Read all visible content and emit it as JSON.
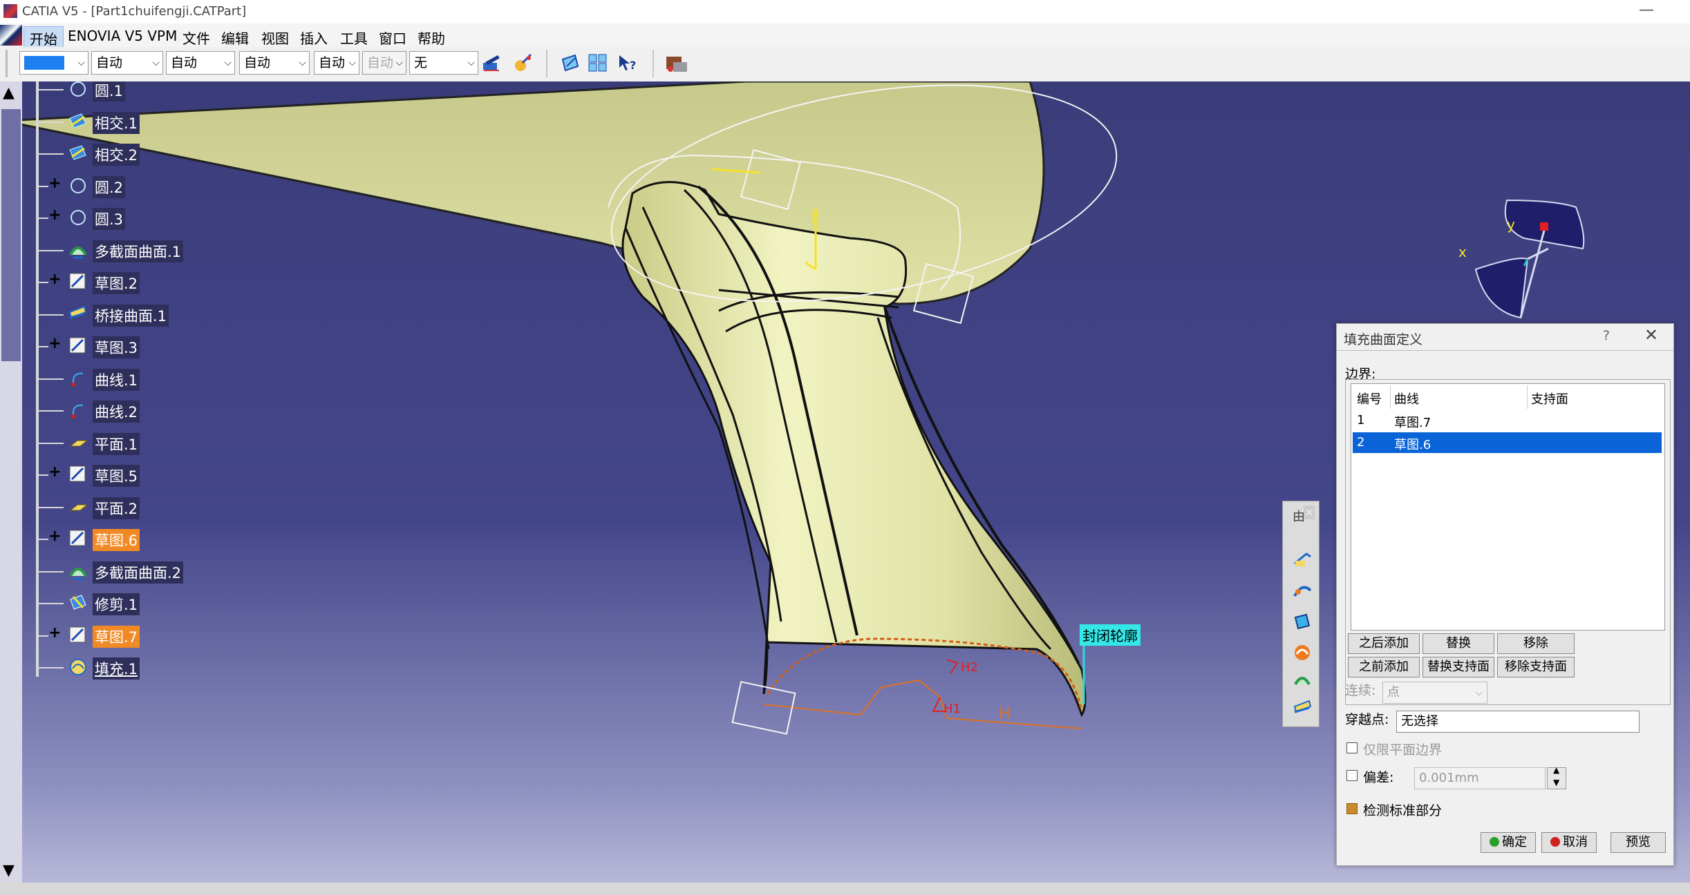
{
  "window": {
    "title": "CATIA V5 - [Part1chuifengji.CATPart]",
    "minimize": "—"
  },
  "menu": {
    "items": [
      "开始",
      "ENOVIA V5 VPM",
      "文件",
      "编辑",
      "视图",
      "插入",
      "工具",
      "窗口",
      "帮助"
    ]
  },
  "toolbar": {
    "color_value": "",
    "combos": [
      "自动",
      "自动",
      "自动",
      "自动",
      "自动",
      "无"
    ]
  },
  "tree": {
    "items": [
      {
        "label": "圆.1",
        "icon": "circle-icon"
      },
      {
        "label": "相交.1",
        "icon": "intersect-icon"
      },
      {
        "label": "相交.2",
        "icon": "intersect-icon"
      },
      {
        "label": "圆.2",
        "icon": "circle-icon"
      },
      {
        "label": "圆.3",
        "icon": "circle-icon"
      },
      {
        "label": "多截面曲面.1",
        "icon": "multisection-surface-icon"
      },
      {
        "label": "草图.2",
        "icon": "sketch-icon"
      },
      {
        "label": "桥接曲面.1",
        "icon": "blend-surface-icon"
      },
      {
        "label": "草图.3",
        "icon": "sketch-icon"
      },
      {
        "label": "曲线.1",
        "icon": "curve-icon"
      },
      {
        "label": "曲线.2",
        "icon": "curve-icon"
      },
      {
        "label": "平面.1",
        "icon": "plane-icon"
      },
      {
        "label": "草图.5",
        "icon": "sketch-icon"
      },
      {
        "label": "平面.2",
        "icon": "plane-icon"
      },
      {
        "label": "草图.6",
        "icon": "sketch-icon"
      },
      {
        "label": "多截面曲面.2",
        "icon": "multisection-surface-icon"
      },
      {
        "label": "修剪.1",
        "icon": "trim-icon"
      },
      {
        "label": "草图.7",
        "icon": "sketch-icon"
      },
      {
        "label": "填充.1",
        "icon": "fill-icon"
      }
    ]
  },
  "viewport": {
    "annotation_label": "封闭轮廓",
    "dim_labels": [
      "H",
      "H1",
      "H2"
    ],
    "axis_labels": {
      "x": "x",
      "y": "y"
    },
    "sketch_axis": "y"
  },
  "palette": {
    "title": "由",
    "close": "×"
  },
  "dialog": {
    "title": "填充曲面定义",
    "help": "?",
    "close": "✕",
    "boundary_label": "边界:",
    "columns": [
      "编号",
      "曲线",
      "支持面"
    ],
    "rows": [
      {
        "num": "1",
        "curve": "草图.7",
        "support": ""
      },
      {
        "num": "2",
        "curve": "草图.6",
        "support": ""
      }
    ],
    "buttons": {
      "add_after": "之后添加",
      "replace": "替换",
      "remove": "移除",
      "add_before": "之前添加",
      "replace_support": "替换支持面",
      "remove_support": "移除支持面"
    },
    "continuity_label": "连续:",
    "continuity_value": "点",
    "passing_point_label": "穿越点:",
    "passing_point_value": "无选择",
    "planar_only_label": "仅限平面边界",
    "deviation_label": "偏差:",
    "deviation_value": "0.001mm",
    "canonical_label": "检测标准部分",
    "ok": "确定",
    "cancel": "取消",
    "preview": "预览"
  },
  "colors": {
    "accent_selection": "#0a64d8",
    "tree_highlight": "#f18a24",
    "surface": "#e6e8b4",
    "background": "#3a3c78"
  }
}
